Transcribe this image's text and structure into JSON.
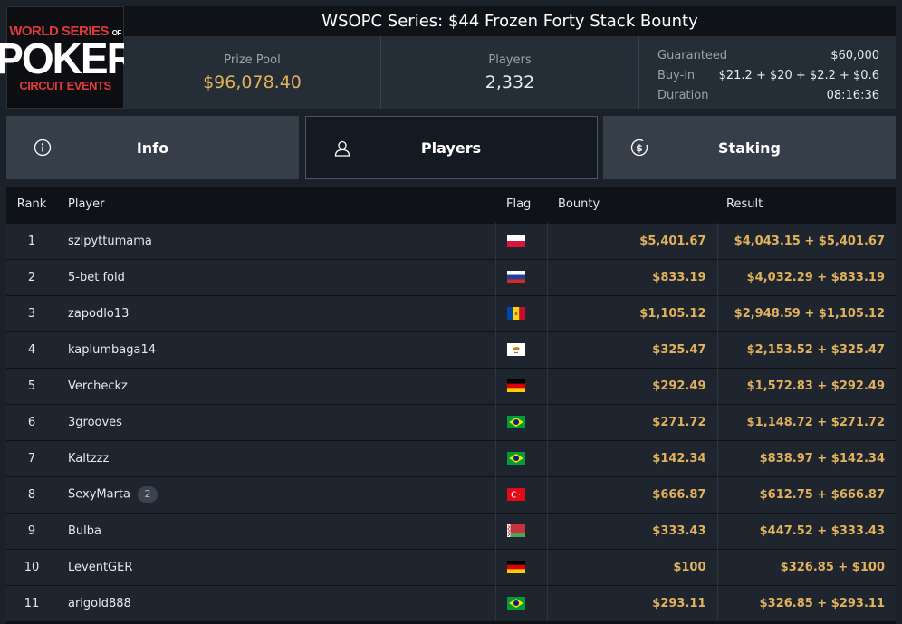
{
  "logo": {
    "line1a": "WORLD SERIES",
    "line1b": "OF",
    "line2": "POKER",
    "line3": "CIRCUIT EVENTS"
  },
  "title": "WSOPC Series: $44 Frozen Forty Stack Bounty",
  "stats": {
    "prize_pool_label": "Prize Pool",
    "prize_pool_value": "$96,078.40",
    "players_label": "Players",
    "players_value": "2,332",
    "details": [
      {
        "label": "Guaranteed",
        "value": "$60,000"
      },
      {
        "label": "Buy-in",
        "value": "$21.2 + $20 + $2.2 + $0.6"
      },
      {
        "label": "Duration",
        "value": "08:16:36"
      }
    ]
  },
  "tabs": [
    {
      "label": "Info",
      "icon": "info-icon",
      "active": false
    },
    {
      "label": "Players",
      "icon": "user-icon",
      "active": true
    },
    {
      "label": "Staking",
      "icon": "dollar-coin-icon",
      "active": false
    }
  ],
  "table": {
    "headers": {
      "rank": "Rank",
      "player": "Player",
      "flag": "Flag",
      "bounty": "Bounty",
      "result": "Result"
    },
    "rows": [
      {
        "rank": "1",
        "player": "szipyttumama",
        "badge": "",
        "flag": "PL",
        "bounty": "$5,401.67",
        "result": "$4,043.15 + $5,401.67"
      },
      {
        "rank": "2",
        "player": "5-bet fold",
        "badge": "",
        "flag": "RU",
        "bounty": "$833.19",
        "result": "$4,032.29 + $833.19"
      },
      {
        "rank": "3",
        "player": "zapodlo13",
        "badge": "",
        "flag": "MD",
        "bounty": "$1,105.12",
        "result": "$2,948.59 + $1,105.12"
      },
      {
        "rank": "4",
        "player": "kaplumbaga14",
        "badge": "",
        "flag": "CY",
        "bounty": "$325.47",
        "result": "$2,153.52 + $325.47"
      },
      {
        "rank": "5",
        "player": "Vercheckz",
        "badge": "",
        "flag": "DE",
        "bounty": "$292.49",
        "result": "$1,572.83 + $292.49"
      },
      {
        "rank": "6",
        "player": "3grooves",
        "badge": "",
        "flag": "BR",
        "bounty": "$271.72",
        "result": "$1,148.72 + $271.72"
      },
      {
        "rank": "7",
        "player": "Kaltzzz",
        "badge": "",
        "flag": "BR",
        "bounty": "$142.34",
        "result": "$838.97 + $142.34"
      },
      {
        "rank": "8",
        "player": "SexyMarta",
        "badge": "2",
        "flag": "TR",
        "bounty": "$666.87",
        "result": "$612.75 + $666.87"
      },
      {
        "rank": "9",
        "player": "Bulba",
        "badge": "",
        "flag": "BY",
        "bounty": "$333.43",
        "result": "$447.52 + $333.43"
      },
      {
        "rank": "10",
        "player": "LeventGER",
        "badge": "",
        "flag": "DE",
        "bounty": "$100",
        "result": "$326.85 + $100"
      },
      {
        "rank": "11",
        "player": "arigold888",
        "badge": "",
        "flag": "BR",
        "bounty": "$293.11",
        "result": "$326.85 + $293.11"
      }
    ]
  },
  "colors": {
    "accent_gold": "#e2b15b",
    "logo_red": "#e03a3a",
    "background": "#1b2129"
  }
}
